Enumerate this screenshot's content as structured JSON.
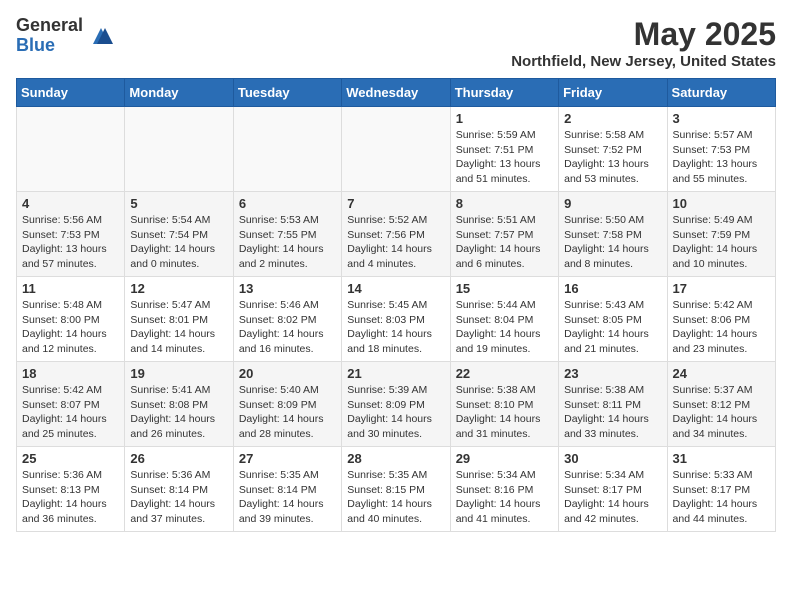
{
  "header": {
    "logo_general": "General",
    "logo_blue": "Blue",
    "title": "May 2025",
    "subtitle": "Northfield, New Jersey, United States"
  },
  "days_of_week": [
    "Sunday",
    "Monday",
    "Tuesday",
    "Wednesday",
    "Thursday",
    "Friday",
    "Saturday"
  ],
  "weeks": [
    [
      {
        "day": "",
        "content": ""
      },
      {
        "day": "",
        "content": ""
      },
      {
        "day": "",
        "content": ""
      },
      {
        "day": "",
        "content": ""
      },
      {
        "day": "1",
        "content": "Sunrise: 5:59 AM\nSunset: 7:51 PM\nDaylight: 13 hours\nand 51 minutes."
      },
      {
        "day": "2",
        "content": "Sunrise: 5:58 AM\nSunset: 7:52 PM\nDaylight: 13 hours\nand 53 minutes."
      },
      {
        "day": "3",
        "content": "Sunrise: 5:57 AM\nSunset: 7:53 PM\nDaylight: 13 hours\nand 55 minutes."
      }
    ],
    [
      {
        "day": "4",
        "content": "Sunrise: 5:56 AM\nSunset: 7:53 PM\nDaylight: 13 hours\nand 57 minutes."
      },
      {
        "day": "5",
        "content": "Sunrise: 5:54 AM\nSunset: 7:54 PM\nDaylight: 14 hours\nand 0 minutes."
      },
      {
        "day": "6",
        "content": "Sunrise: 5:53 AM\nSunset: 7:55 PM\nDaylight: 14 hours\nand 2 minutes."
      },
      {
        "day": "7",
        "content": "Sunrise: 5:52 AM\nSunset: 7:56 PM\nDaylight: 14 hours\nand 4 minutes."
      },
      {
        "day": "8",
        "content": "Sunrise: 5:51 AM\nSunset: 7:57 PM\nDaylight: 14 hours\nand 6 minutes."
      },
      {
        "day": "9",
        "content": "Sunrise: 5:50 AM\nSunset: 7:58 PM\nDaylight: 14 hours\nand 8 minutes."
      },
      {
        "day": "10",
        "content": "Sunrise: 5:49 AM\nSunset: 7:59 PM\nDaylight: 14 hours\nand 10 minutes."
      }
    ],
    [
      {
        "day": "11",
        "content": "Sunrise: 5:48 AM\nSunset: 8:00 PM\nDaylight: 14 hours\nand 12 minutes."
      },
      {
        "day": "12",
        "content": "Sunrise: 5:47 AM\nSunset: 8:01 PM\nDaylight: 14 hours\nand 14 minutes."
      },
      {
        "day": "13",
        "content": "Sunrise: 5:46 AM\nSunset: 8:02 PM\nDaylight: 14 hours\nand 16 minutes."
      },
      {
        "day": "14",
        "content": "Sunrise: 5:45 AM\nSunset: 8:03 PM\nDaylight: 14 hours\nand 18 minutes."
      },
      {
        "day": "15",
        "content": "Sunrise: 5:44 AM\nSunset: 8:04 PM\nDaylight: 14 hours\nand 19 minutes."
      },
      {
        "day": "16",
        "content": "Sunrise: 5:43 AM\nSunset: 8:05 PM\nDaylight: 14 hours\nand 21 minutes."
      },
      {
        "day": "17",
        "content": "Sunrise: 5:42 AM\nSunset: 8:06 PM\nDaylight: 14 hours\nand 23 minutes."
      }
    ],
    [
      {
        "day": "18",
        "content": "Sunrise: 5:42 AM\nSunset: 8:07 PM\nDaylight: 14 hours\nand 25 minutes."
      },
      {
        "day": "19",
        "content": "Sunrise: 5:41 AM\nSunset: 8:08 PM\nDaylight: 14 hours\nand 26 minutes."
      },
      {
        "day": "20",
        "content": "Sunrise: 5:40 AM\nSunset: 8:09 PM\nDaylight: 14 hours\nand 28 minutes."
      },
      {
        "day": "21",
        "content": "Sunrise: 5:39 AM\nSunset: 8:09 PM\nDaylight: 14 hours\nand 30 minutes."
      },
      {
        "day": "22",
        "content": "Sunrise: 5:38 AM\nSunset: 8:10 PM\nDaylight: 14 hours\nand 31 minutes."
      },
      {
        "day": "23",
        "content": "Sunrise: 5:38 AM\nSunset: 8:11 PM\nDaylight: 14 hours\nand 33 minutes."
      },
      {
        "day": "24",
        "content": "Sunrise: 5:37 AM\nSunset: 8:12 PM\nDaylight: 14 hours\nand 34 minutes."
      }
    ],
    [
      {
        "day": "25",
        "content": "Sunrise: 5:36 AM\nSunset: 8:13 PM\nDaylight: 14 hours\nand 36 minutes."
      },
      {
        "day": "26",
        "content": "Sunrise: 5:36 AM\nSunset: 8:14 PM\nDaylight: 14 hours\nand 37 minutes."
      },
      {
        "day": "27",
        "content": "Sunrise: 5:35 AM\nSunset: 8:14 PM\nDaylight: 14 hours\nand 39 minutes."
      },
      {
        "day": "28",
        "content": "Sunrise: 5:35 AM\nSunset: 8:15 PM\nDaylight: 14 hours\nand 40 minutes."
      },
      {
        "day": "29",
        "content": "Sunrise: 5:34 AM\nSunset: 8:16 PM\nDaylight: 14 hours\nand 41 minutes."
      },
      {
        "day": "30",
        "content": "Sunrise: 5:34 AM\nSunset: 8:17 PM\nDaylight: 14 hours\nand 42 minutes."
      },
      {
        "day": "31",
        "content": "Sunrise: 5:33 AM\nSunset: 8:17 PM\nDaylight: 14 hours\nand 44 minutes."
      }
    ]
  ]
}
